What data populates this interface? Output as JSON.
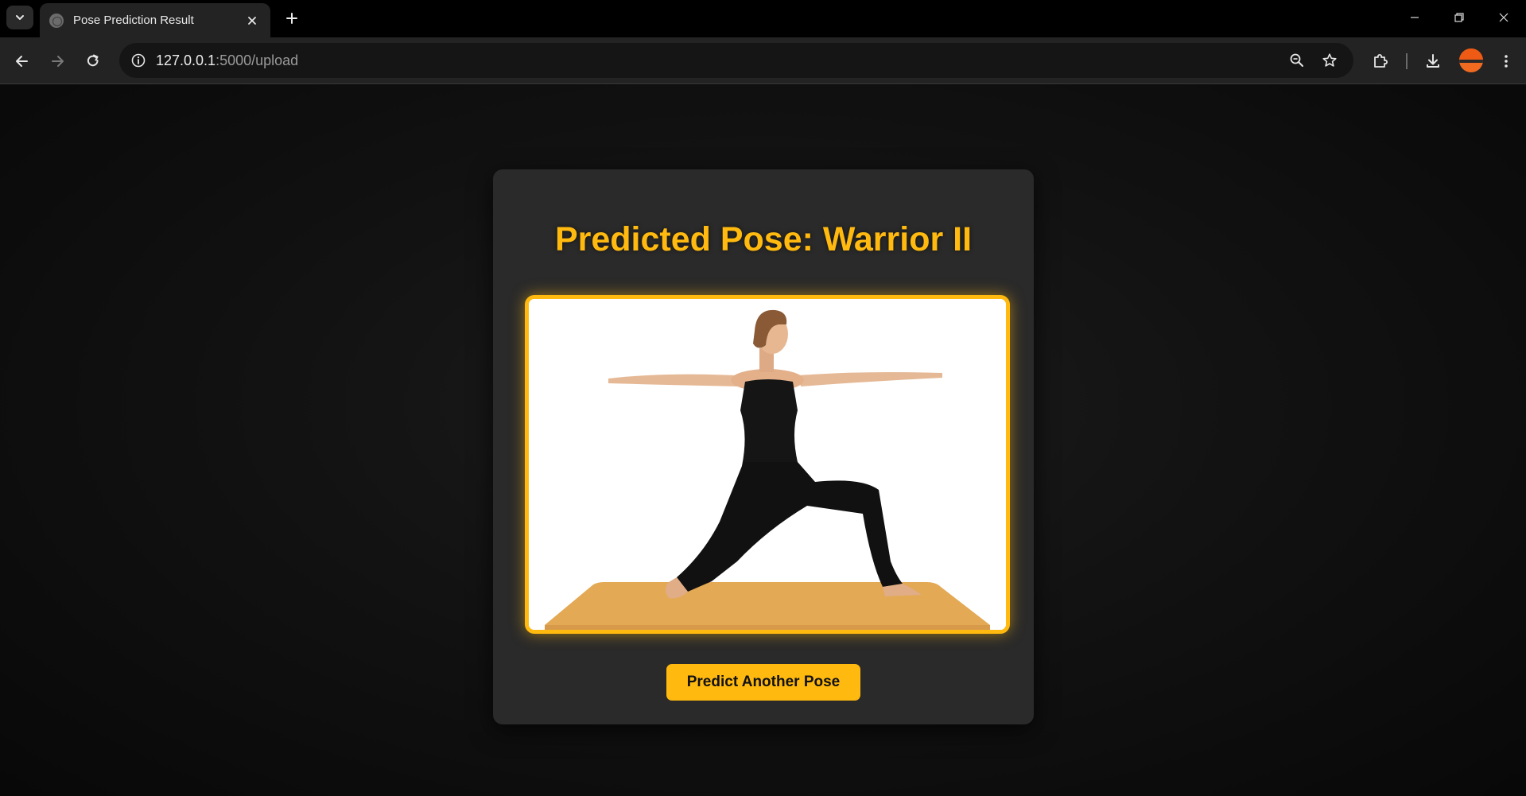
{
  "browser": {
    "tab_title": "Pose Prediction Result",
    "url_host": "127.0.0.1",
    "url_rest": ":5000/upload"
  },
  "icons": {
    "tab_search": "chevron-down-icon",
    "tab_favicon": "globe-icon",
    "tab_close": "close-icon",
    "new_tab": "plus-icon",
    "back": "arrow-left-icon",
    "forward": "arrow-right-icon",
    "reload": "reload-icon",
    "site_info": "info-icon",
    "zoom": "zoom-icon",
    "bookmark": "star-icon",
    "extensions": "puzzle-icon",
    "downloads": "download-icon",
    "menu": "more-vert-icon"
  },
  "result": {
    "title": "Predicted Pose: Warrior II",
    "button_label": "Predict Another Pose"
  },
  "colors": {
    "accent": "#ffb90f",
    "card_bg": "#2a2a2a",
    "page_bg": "#0b0b0b"
  }
}
